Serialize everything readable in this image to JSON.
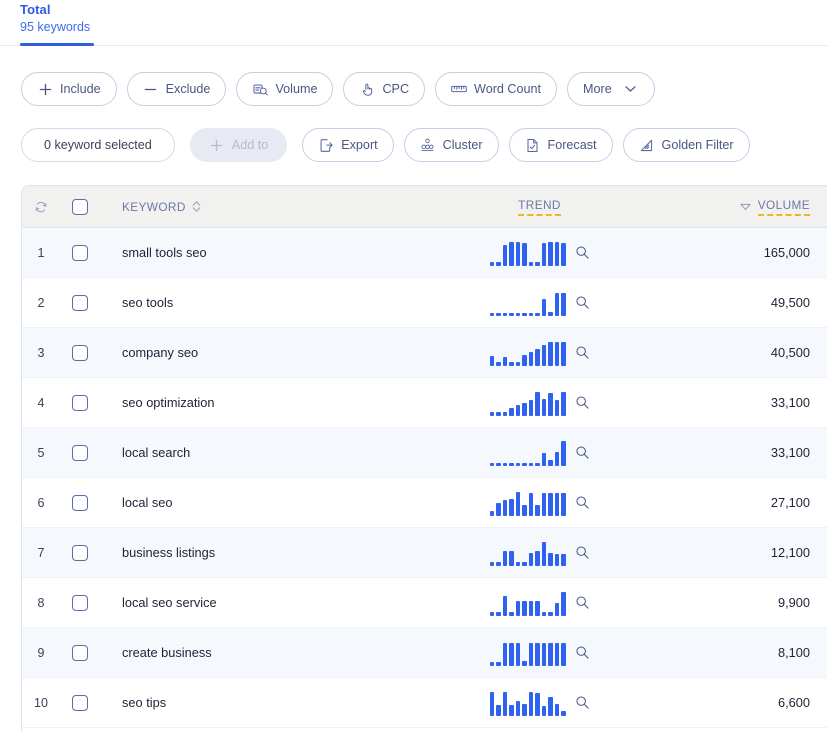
{
  "tab": {
    "title": "Total",
    "subtitle": "95 keywords",
    "accent": "#2f5fe0"
  },
  "filters": [
    {
      "label": "Include",
      "icon": "plus-icon"
    },
    {
      "label": "Exclude",
      "icon": "minus-icon"
    },
    {
      "label": "Volume",
      "icon": "volume-search-icon"
    },
    {
      "label": "CPC",
      "icon": "click-hand-icon"
    },
    {
      "label": "Word Count",
      "icon": "ruler-icon"
    },
    {
      "label": "More",
      "icon": "chevron-down-icon"
    }
  ],
  "actions": {
    "selection_label": "0 keyword selected",
    "items": [
      {
        "label": "Add to",
        "icon": "plus-icon",
        "disabled": true
      },
      {
        "label": "Export",
        "icon": "export-icon",
        "disabled": false
      },
      {
        "label": "Cluster",
        "icon": "cluster-icon",
        "disabled": false
      },
      {
        "label": "Forecast",
        "icon": "forecast-icon",
        "disabled": false
      },
      {
        "label": "Golden Filter",
        "icon": "golden-filter-icon",
        "disabled": false
      }
    ]
  },
  "table": {
    "headers": {
      "refresh_icon": "refresh-icon",
      "select_all": "select-all-checkbox",
      "keyword": "KEYWORD",
      "trend": "TREND",
      "volume": "VOLUME"
    },
    "header_accent_underline": "#f0b429",
    "rows": [
      {
        "index": "1",
        "keyword": "small tools seo",
        "volume": "165,000",
        "trend": [
          12,
          12,
          78,
          90,
          90,
          88,
          12,
          12,
          88,
          90,
          90,
          88
        ]
      },
      {
        "index": "2",
        "keyword": "seo tools",
        "volume": "49,500",
        "trend": [
          10,
          10,
          10,
          10,
          10,
          10,
          10,
          10,
          62,
          12,
          88,
          86
        ]
      },
      {
        "index": "3",
        "keyword": "company seo",
        "volume": "40,500",
        "trend": [
          38,
          14,
          32,
          14,
          14,
          42,
          52,
          62,
          78,
          92,
          92,
          92
        ]
      },
      {
        "index": "4",
        "keyword": "seo optimization",
        "volume": "33,100",
        "trend": [
          12,
          12,
          12,
          30,
          42,
          48,
          58,
          90,
          62,
          86,
          60,
          92
        ]
      },
      {
        "index": "5",
        "keyword": "local search",
        "volume": "33,100",
        "trend": [
          10,
          10,
          10,
          10,
          10,
          10,
          10,
          10,
          48,
          22,
          52,
          96
        ]
      },
      {
        "index": "6",
        "keyword": "local seo",
        "volume": "27,100",
        "trend": [
          18,
          50,
          58,
          62,
          92,
          40,
          88,
          42,
          88,
          88,
          88,
          88
        ]
      },
      {
        "index": "7",
        "keyword": "business listings",
        "volume": "12,100",
        "trend": [
          12,
          12,
          56,
          56,
          12,
          12,
          50,
          54,
          92,
          50,
          46,
          46
        ]
      },
      {
        "index": "8",
        "keyword": "local seo service",
        "volume": "9,900",
        "trend": [
          12,
          12,
          74,
          14,
          54,
          56,
          54,
          54,
          14,
          14,
          48,
          92
        ]
      },
      {
        "index": "9",
        "keyword": "create business",
        "volume": "8,100",
        "trend": [
          14,
          14,
          88,
          88,
          88,
          16,
          88,
          88,
          88,
          88,
          88,
          88
        ]
      },
      {
        "index": "10",
        "keyword": "seo tips",
        "volume": "6,600",
        "trend": [
          92,
          40,
          92,
          40,
          56,
          44,
          90,
          88,
          38,
          72,
          46,
          16
        ]
      }
    ]
  }
}
